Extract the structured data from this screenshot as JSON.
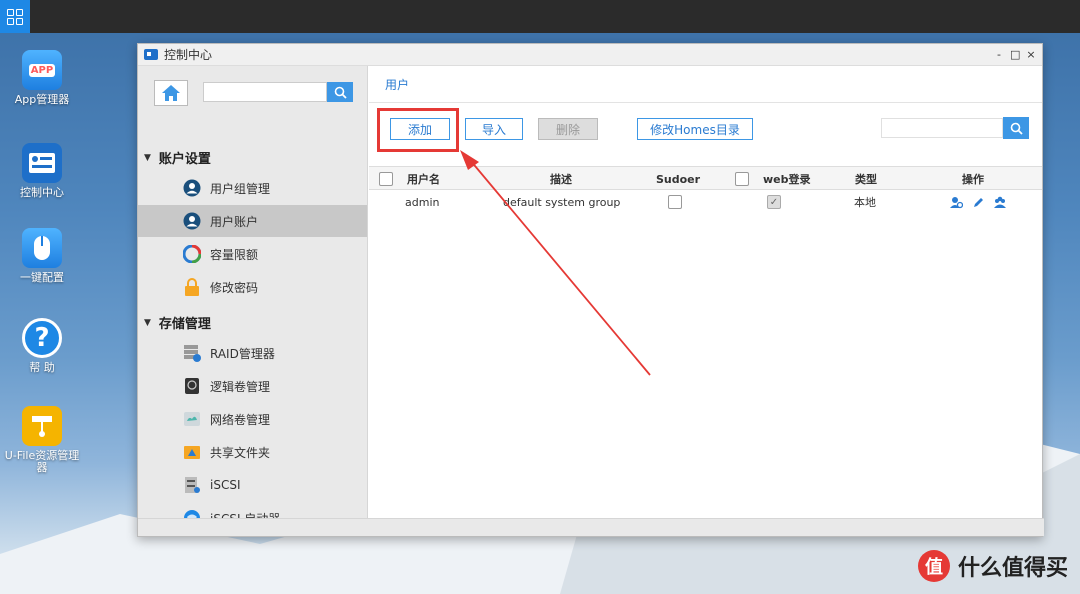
{
  "desktop": {
    "icons": [
      {
        "label": "App管理器",
        "icon": "app-store-icon",
        "badge": "APP"
      },
      {
        "label": "控制中心",
        "icon": "control-center-icon"
      },
      {
        "label": "一键配置",
        "icon": "mouse-icon"
      },
      {
        "label": "帮 助",
        "icon": "help-icon",
        "glyph": "?"
      },
      {
        "label": "U-File资源管理器",
        "icon": "file-manager-icon"
      }
    ]
  },
  "window": {
    "title": "控制中心",
    "controls": {
      "minimize": "-",
      "maximize": "□",
      "close": "×"
    }
  },
  "sidebar": {
    "search_value": "",
    "groups": [
      {
        "label": "账户设置",
        "items": [
          {
            "label": "用户组管理",
            "icon": "user-group-icon"
          },
          {
            "label": "用户账户",
            "icon": "user-account-icon",
            "active": true
          },
          {
            "label": "容量限额",
            "icon": "quota-icon"
          },
          {
            "label": "修改密码",
            "icon": "lock-icon"
          }
        ]
      },
      {
        "label": "存储管理",
        "items": [
          {
            "label": "RAID管理器",
            "icon": "raid-icon"
          },
          {
            "label": "逻辑卷管理",
            "icon": "logical-volume-icon"
          },
          {
            "label": "网络卷管理",
            "icon": "network-volume-icon"
          },
          {
            "label": "共享文件夹",
            "icon": "shared-folder-icon"
          },
          {
            "label": "iSCSI",
            "icon": "iscsi-icon"
          },
          {
            "label": "iSCSI 启动器",
            "icon": "iscsi-initiator-icon"
          }
        ]
      }
    ]
  },
  "main": {
    "breadcrumb": "用户",
    "toolbar": {
      "add": "添加",
      "import": "导入",
      "delete": "删除",
      "modify_homes": "修改Homes目录",
      "search_value": ""
    },
    "table": {
      "columns": [
        "用户名",
        "描述",
        "Sudoer",
        "web登录",
        "类型",
        "操作"
      ],
      "rows": [
        {
          "username": "admin",
          "description": "default system group",
          "sudoer": false,
          "web_login": true,
          "type": "本地"
        }
      ]
    }
  },
  "watermark": {
    "glyph": "值",
    "text": "什么值得买"
  },
  "colors": {
    "accent": "#3d97e5",
    "highlight": "#e53935"
  }
}
